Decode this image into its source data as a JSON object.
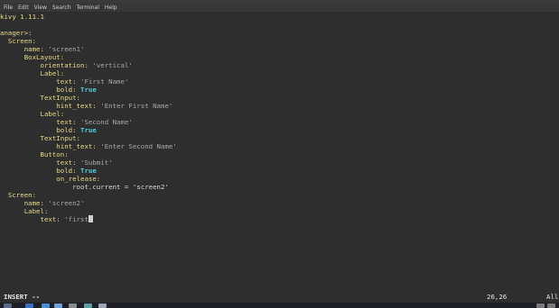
{
  "menubar": [
    "File",
    "Edit",
    "View",
    "Search",
    "Terminal",
    "Help"
  ],
  "editor": {
    "lines": [
      [
        [
          "kivy 1.11.1",
          "k"
        ]
      ],
      [
        [
          "",
          "p"
        ]
      ],
      [
        [
          "anager>:",
          "k"
        ]
      ],
      [
        [
          "  Screen:",
          "k"
        ]
      ],
      [
        [
          "      name: ",
          "k"
        ],
        [
          "'screen1'",
          "s"
        ]
      ],
      [
        [
          "      BoxLayout:",
          "k"
        ]
      ],
      [
        [
          "          orientation: ",
          "k"
        ],
        [
          "'vertical'",
          "s"
        ]
      ],
      [
        [
          "          Label:",
          "k"
        ]
      ],
      [
        [
          "              text: ",
          "k"
        ],
        [
          "'First Name'",
          "s"
        ]
      ],
      [
        [
          "              bold: ",
          "k"
        ],
        [
          "True",
          "b"
        ]
      ],
      [
        [
          "          TextInput:",
          "k"
        ]
      ],
      [
        [
          "              hint_text: ",
          "k"
        ],
        [
          "'Enter First Name'",
          "s"
        ]
      ],
      [
        [
          "          Label:",
          "k"
        ]
      ],
      [
        [
          "              text: ",
          "k"
        ],
        [
          "'Second Name'",
          "s"
        ]
      ],
      [
        [
          "              bold: ",
          "k"
        ],
        [
          "True",
          "b"
        ]
      ],
      [
        [
          "          TextInput:",
          "k"
        ]
      ],
      [
        [
          "              hint_text: ",
          "k"
        ],
        [
          "'Enter Second Name'",
          "s"
        ]
      ],
      [
        [
          "          Button:",
          "k"
        ]
      ],
      [
        [
          "              text: ",
          "k"
        ],
        [
          "'Submit'",
          "s"
        ]
      ],
      [
        [
          "              bold: ",
          "k"
        ],
        [
          "True",
          "b"
        ]
      ],
      [
        [
          "              on_release:",
          "k"
        ]
      ],
      [
        [
          "                  root.current = ",
          "p"
        ],
        [
          "'screen2'",
          "p"
        ]
      ],
      [
        [
          "  Screen:",
          "k"
        ]
      ],
      [
        [
          "      name: ",
          "k"
        ],
        [
          "'screen2'",
          "s"
        ]
      ],
      [
        [
          "      Label:",
          "k"
        ]
      ],
      [
        [
          "          text: ",
          "k"
        ],
        [
          "'first",
          "s"
        ]
      ]
    ]
  },
  "statusbar": {
    "mode": "INSERT --",
    "position": "26,26",
    "scroll": "All"
  },
  "colors": {
    "background": "#2e2e2e",
    "keyword": "#e9db86",
    "string": "#a8a8a8",
    "boolean": "#4fd1d9"
  }
}
